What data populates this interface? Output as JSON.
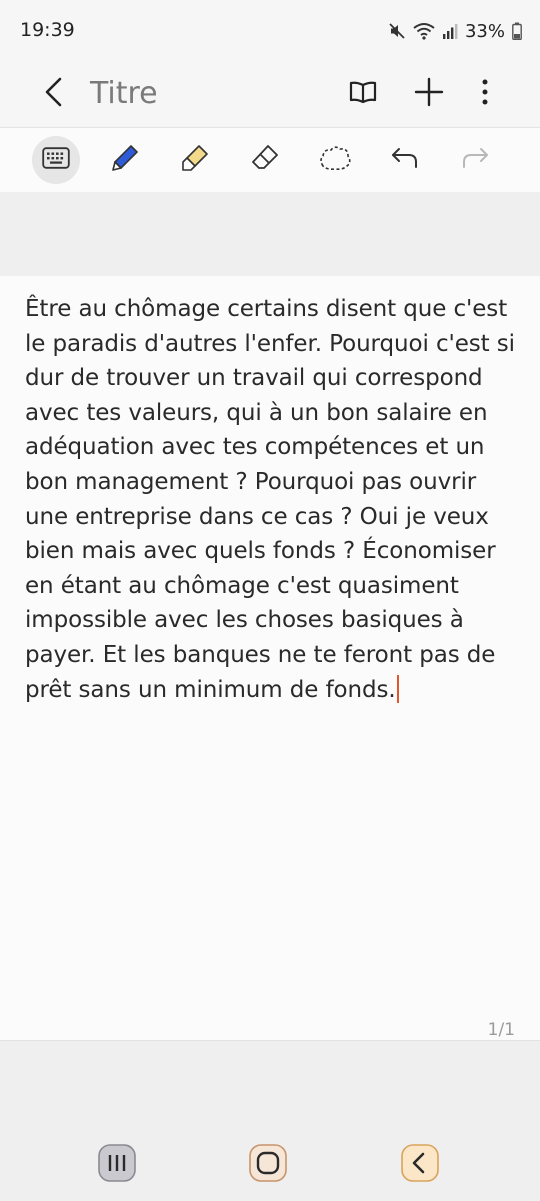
{
  "status_bar": {
    "time": "19:39",
    "battery": "33%",
    "icons": [
      "mute-icon",
      "wifi-icon",
      "signal-icon",
      "battery-icon"
    ]
  },
  "app_bar": {
    "title": "Titre",
    "icons": [
      "back-arrow-icon",
      "book-icon",
      "plus-icon",
      "more-vertical-icon"
    ]
  },
  "toolbar": {
    "tools": [
      "keyboard-icon",
      "pen-icon",
      "highlighter-icon",
      "eraser-icon",
      "lasso-icon",
      "undo-icon",
      "redo-icon"
    ],
    "active_tool": "keyboard-icon",
    "colors": {
      "pen": "#2e5bd8",
      "highlighter": "#f3d98a",
      "active_background": "#e6e6e6",
      "redo_disabled": "#b8b8b8"
    }
  },
  "note": {
    "lines": [
      "Être au chômage certains disent que c'est",
      "le paradis d'autres l'enfer. Pourquoi c'est si",
      "dur de trouver un travail qui correspond",
      "avec tes valeurs, qui à un bon salaire en",
      "adéquation avec tes compétences et un",
      "bon management ? Pourquoi pas ouvrir",
      "une entreprise dans ce cas ? Oui je veux",
      "bien mais avec quels fonds ? Économiser",
      "en étant au chômage c'est quasiment",
      "impossible avec les choses basiques à",
      "payer. Et les banques ne te feront pas de",
      "prêt sans un minimum de fonds."
    ],
    "cursor_color": "#e0572b"
  },
  "page_indicator": "1/1",
  "nav_bar": {
    "icons": [
      "recents-icon",
      "home-icon",
      "back-icon"
    ]
  }
}
